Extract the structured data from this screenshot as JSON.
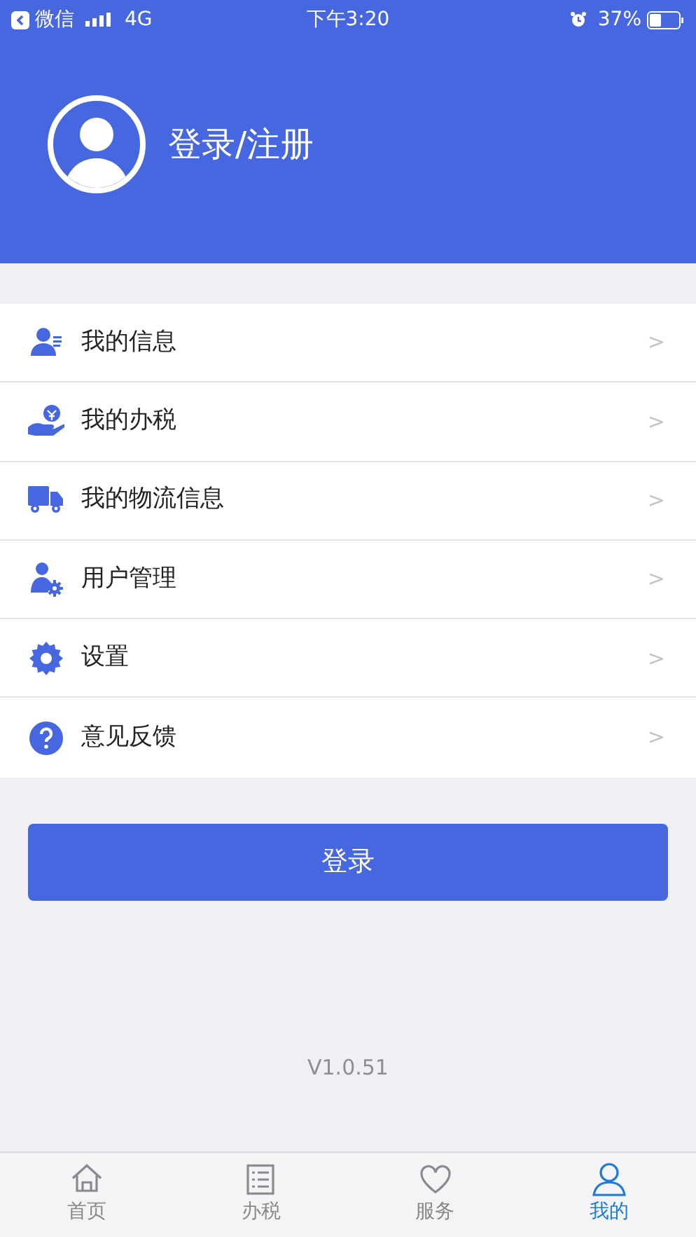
{
  "status_bar": {
    "back_app": "微信",
    "network": "4G",
    "time": "下午3:20",
    "battery": "37%"
  },
  "profile": {
    "login_label": "登录/注册"
  },
  "menu": [
    {
      "kind": "info",
      "label": "我的信息",
      "chevron": ">"
    },
    {
      "kind": "tax",
      "label": "我的办税",
      "chevron": ">"
    },
    {
      "kind": "truck",
      "label": "我的物流信息",
      "chevron": ">"
    },
    {
      "kind": "user-admin",
      "label": "用户管理",
      "chevron": ">"
    },
    {
      "kind": "settings",
      "label": "设置",
      "chevron": ">"
    },
    {
      "kind": "help",
      "label": "意见反馈",
      "chevron": ">"
    }
  ],
  "login_button": "登录",
  "version": "V1.0.51",
  "tab_bar": [
    {
      "kind": "home",
      "label": "首页",
      "selected": false
    },
    {
      "kind": "list",
      "label": "办税",
      "selected": false
    },
    {
      "kind": "heart",
      "label": "服务",
      "selected": false
    },
    {
      "kind": "person",
      "label": "我的",
      "selected": true
    }
  ]
}
